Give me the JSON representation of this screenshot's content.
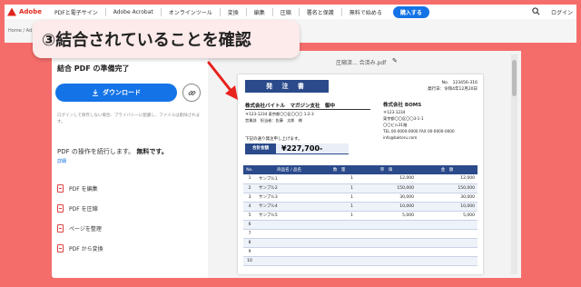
{
  "nav": {
    "brand": "Adobe",
    "items": [
      "PDFと電子サイン",
      "Adobe Acrobat",
      "オンラインツール",
      "変換",
      "編集",
      "圧縮",
      "署名と保護",
      "無料で始める"
    ],
    "buy": "購入する",
    "login": "ログイン"
  },
  "breadcrumb": "Home  /  Ad",
  "left": {
    "title": "結合 PDF の準備完了",
    "download": "ダウンロード",
    "note": "ログインして保存しない場合、プライバシーに配慮し、ファイルは削除されます。",
    "continue_prefix": "PDF の操作を続行します。",
    "continue_bold": "無料です。",
    "details": "詳細",
    "actions": [
      "PDF を編集",
      "PDF を圧縮",
      "ページを整理",
      "PDF から変換"
    ]
  },
  "preview": {
    "file_name": "圧縮済... 合済み.pdf"
  },
  "annotation": {
    "text": "③結合されていることを確認"
  },
  "doc": {
    "title": "発 注 書",
    "number_label": "No.",
    "number": "123456-316",
    "date_label": "発行日：",
    "date": "令和4年12月20日",
    "to": "株式会社バイトル　マガジン支社　御中",
    "to_addr1": "〒123-1234 東京都〇〇区〇〇〇 1-2-3",
    "to_addr2": "営業部　担当者：佐藤　太郎　様",
    "from_name": "株式会社 BOMS",
    "from_addr1": "〒123-1234",
    "from_addr2": "東京都〇〇区〇〇3-1-1",
    "from_addr3": "〇〇ビル31階",
    "from_tel": "TEL 00-0000-0000  FAX 00-0000-0000",
    "from_mail": "info@baitoru.com",
    "order_text": "下記の通り発注申し上げます。",
    "total_label": "合計金額",
    "total_value": "¥227,700-",
    "headers": [
      "No.",
      "商品名 / 品名",
      "数　量",
      "単　価",
      "金　額"
    ],
    "rows": [
      [
        "1",
        "サンプル1",
        "1",
        "12,000",
        "12,000"
      ],
      [
        "2",
        "サンプル2",
        "1",
        "150,000",
        "150,000"
      ],
      [
        "3",
        "サンプル3",
        "1",
        "30,000",
        "30,000"
      ],
      [
        "4",
        "サンプル4",
        "1",
        "10,000",
        "10,000"
      ],
      [
        "5",
        "サンプル5",
        "1",
        "5,000",
        "5,000"
      ],
      [
        "6",
        "",
        "",
        "",
        ""
      ],
      [
        "7",
        "",
        "",
        "",
        ""
      ],
      [
        "8",
        "",
        "",
        "",
        ""
      ],
      [
        "9",
        "",
        "",
        "",
        ""
      ],
      [
        "10",
        "",
        "",
        "",
        ""
      ]
    ]
  },
  "colors": {
    "accent": "#1473e6",
    "background": "#f56d6b",
    "doc_blue": "#2b4a8b",
    "arrow": "#e8231d"
  }
}
